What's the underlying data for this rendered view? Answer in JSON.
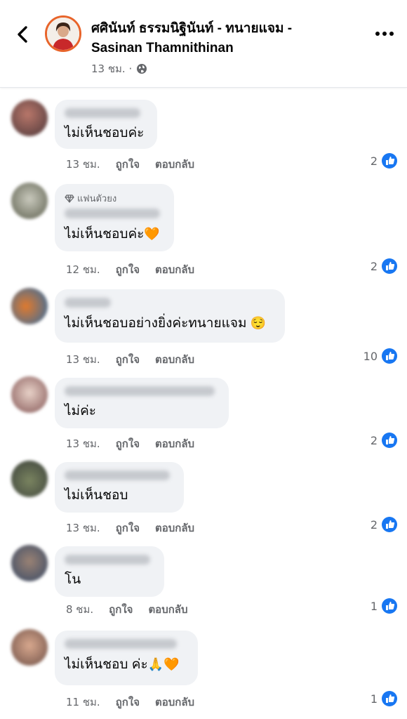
{
  "header": {
    "back_icon": "chevron-left-icon",
    "title": "ศศินันท์ ธรรมนิฐินันท์ - ทนายแจม - Sasinan Thamnithinan",
    "time": "13 ชม. ·",
    "privacy_icon": "globe-icon",
    "more_icon": "more-dots-icon"
  },
  "labels": {
    "like": "ถูกใจ",
    "reply": "ตอบกลับ",
    "fan_badge": "แฟนตัวยง"
  },
  "comments": [
    {
      "text": "ไม่เห็นชอบค่ะ",
      "time": "13 ชม.",
      "likes": "2",
      "emoji": ""
    },
    {
      "text": "ไม่เห็นชอบค่ะ",
      "time": "12 ชม.",
      "likes": "2",
      "emoji": "🧡"
    },
    {
      "text": "ไม่เห็นชอบอย่างยิ่งค่ะทนายแจม",
      "time": "13 ชม.",
      "likes": "10",
      "emoji": "😌"
    },
    {
      "text": "ไม่ค่ะ",
      "time": "13 ชม.",
      "likes": "2",
      "emoji": ""
    },
    {
      "text": "ไม่เห็นชอบ",
      "time": "13 ชม.",
      "likes": "2",
      "emoji": ""
    },
    {
      "text": "โน",
      "time": "8 ชม.",
      "likes": "1",
      "emoji": ""
    },
    {
      "text": "ไม่เห็นชอบ ค่ะ",
      "time": "11 ชม.",
      "likes": "1",
      "emoji": "🙏🧡"
    }
  ],
  "colors": {
    "like_blue": "#1877f2",
    "bubble_bg": "#f0f2f5",
    "meta_gray": "#65676b",
    "avatar_ring": "#e8642a"
  }
}
